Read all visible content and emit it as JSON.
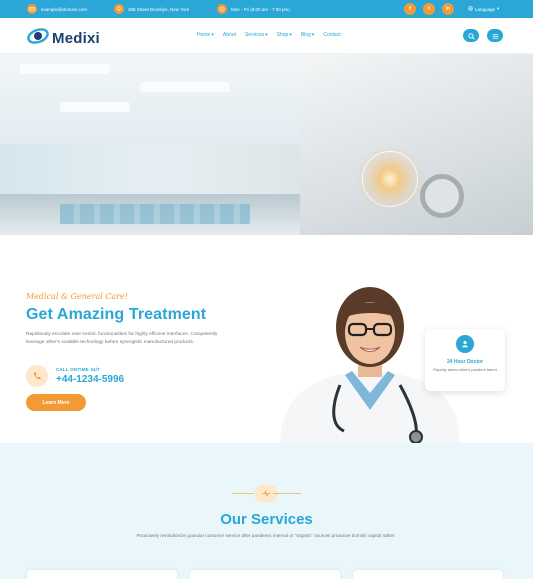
{
  "topbar": {
    "email": "example@domain.com",
    "address": "368 Street Brooklyn, New York",
    "hours": "Mon - Fri (8:00 am - 7:00 pm)",
    "language": "Language",
    "social": [
      "f",
      "t",
      "in"
    ]
  },
  "header": {
    "logo": "Medixi",
    "nav": [
      {
        "label": "Home",
        "dropdown": true
      },
      {
        "label": "About",
        "dropdown": false
      },
      {
        "label": "Services",
        "dropdown": true
      },
      {
        "label": "Shop",
        "dropdown": true
      },
      {
        "label": "Blog",
        "dropdown": true
      },
      {
        "label": "Contact",
        "dropdown": false
      }
    ]
  },
  "about": {
    "tagline": "Medical & General Care!",
    "heading": "Get Amazing Treatment",
    "description": "Rapidiously enculate user-centric functionalities for highly efficient interfaces. Competently leverage other's scalable technology before synergistic manufactured products.",
    "call_label": "CALL ONTIME 24/7",
    "phone": "+44-1234-5996",
    "button": "Learn More",
    "card": {
      "title": "24 Hour Doctor",
      "text": "Rapidly taxes other's pandem talent"
    }
  },
  "services": {
    "title": "Our Services",
    "description": "Proactively revolutionize granular customer service after pandemic internal or \"organic\" sources proactive burnish capital rather."
  },
  "colors": {
    "primary": "#2aa7d6",
    "accent": "#f39a34",
    "navy": "#1e3f6f",
    "services_bg": "#e9f7fb"
  }
}
